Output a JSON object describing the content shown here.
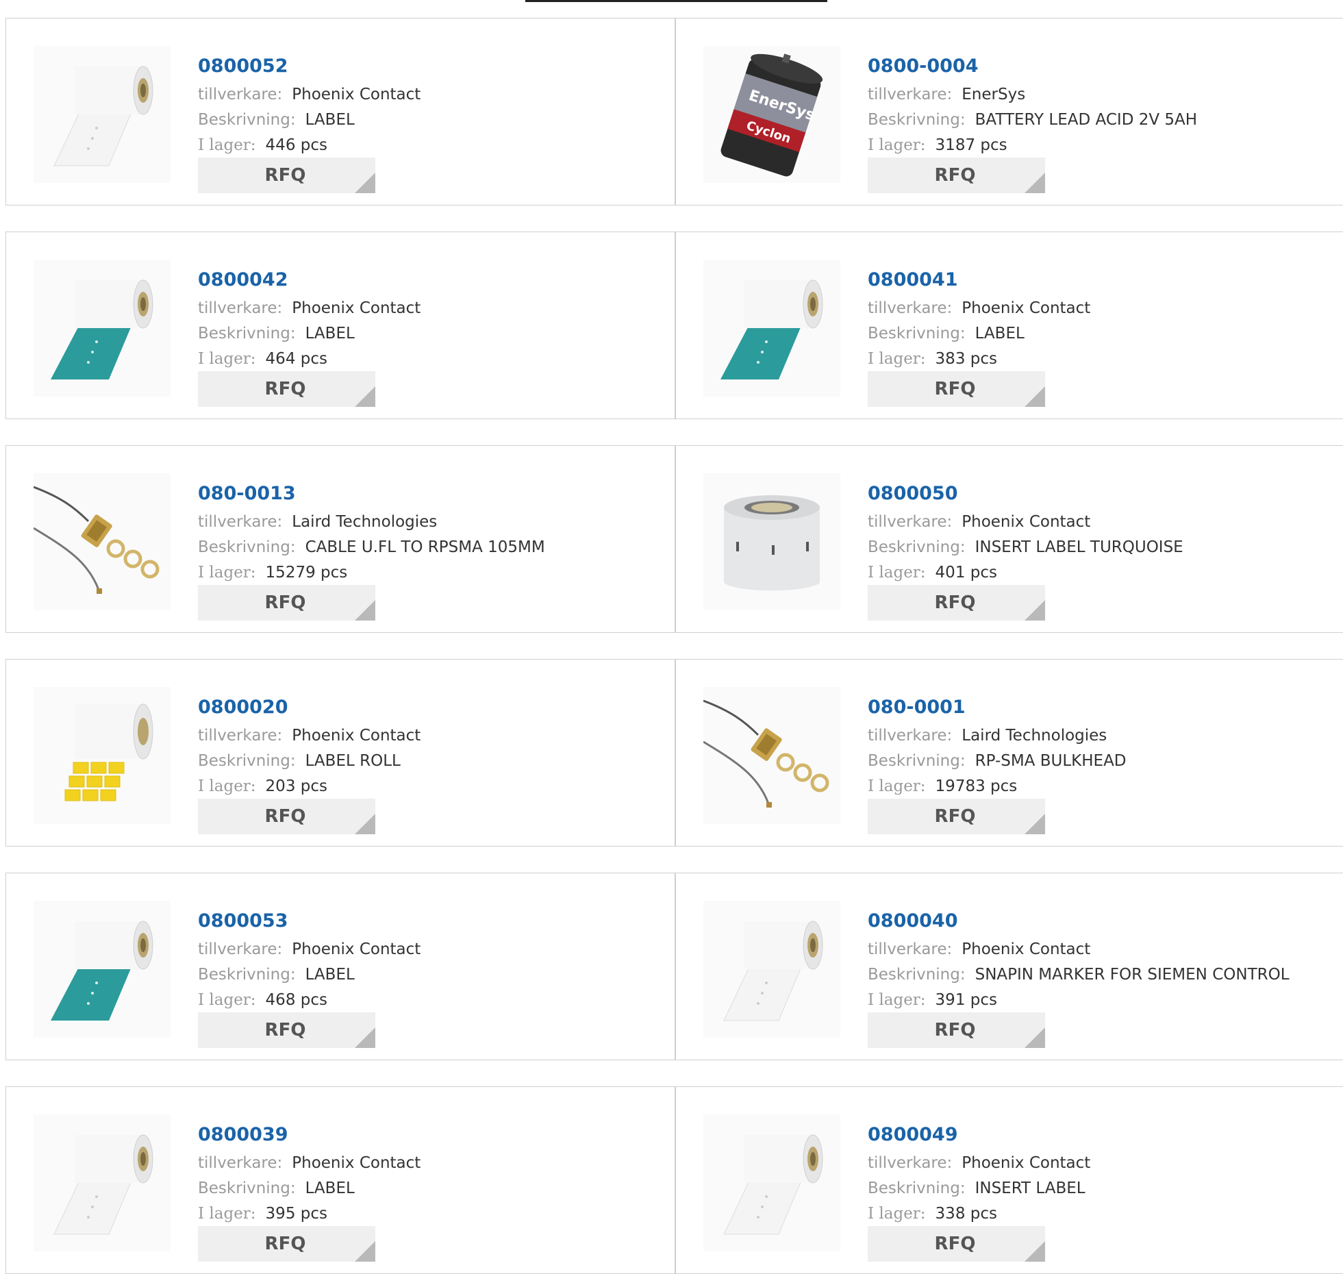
{
  "labels": {
    "manufacturer": "tillverkare:",
    "description": "Beskrivning:",
    "stock": "I lager:",
    "rfq": "RFQ"
  },
  "colors": {
    "part_link": "#1a63a8",
    "label_text": "#9a9a9a",
    "rfq_bg": "#efefef"
  },
  "products": [
    {
      "part": "0800052",
      "manufacturer": "Phoenix Contact",
      "description": "LABEL",
      "stock": "446 pcs",
      "image": "white-label-roll-icon"
    },
    {
      "part": "0800-0004",
      "manufacturer": "EnerSys",
      "description": "BATTERY LEAD ACID 2V 5AH",
      "stock": "3187 pcs",
      "image": "battery-icon"
    },
    {
      "part": "0800042",
      "manufacturer": "Phoenix Contact",
      "description": "LABEL",
      "stock": "464 pcs",
      "image": "teal-label-roll-icon"
    },
    {
      "part": "0800041",
      "manufacturer": "Phoenix Contact",
      "description": "LABEL",
      "stock": "383 pcs",
      "image": "teal-label-roll-icon"
    },
    {
      "part": "080-0013",
      "manufacturer": "Laird Technologies",
      "description": "CABLE U.FL TO RPSMA 105MM",
      "stock": "15279 pcs",
      "image": "rf-cable-icon"
    },
    {
      "part": "0800050",
      "manufacturer": "Phoenix Contact",
      "description": "INSERT LABEL TURQUOISE",
      "stock": "401 pcs",
      "image": "insert-label-roll-icon"
    },
    {
      "part": "0800020",
      "manufacturer": "Phoenix Contact",
      "description": "LABEL ROLL",
      "stock": "203 pcs",
      "image": "yellow-label-roll-icon"
    },
    {
      "part": "080-0001",
      "manufacturer": "Laird Technologies",
      "description": "RP-SMA BULKHEAD",
      "stock": "19783 pcs",
      "image": "rf-cable-icon"
    },
    {
      "part": "0800053",
      "manufacturer": "Phoenix Contact",
      "description": "LABEL",
      "stock": "468 pcs",
      "image": "teal-label-roll-icon"
    },
    {
      "part": "0800040",
      "manufacturer": "Phoenix Contact",
      "description": "SNAPIN MARKER FOR SIEMEN CONTROL",
      "stock": "391 pcs",
      "image": "white-label-roll-icon"
    },
    {
      "part": "0800039",
      "manufacturer": "Phoenix Contact",
      "description": "LABEL",
      "stock": "395 pcs",
      "image": "white-label-roll-icon"
    },
    {
      "part": "0800049",
      "manufacturer": "Phoenix Contact",
      "description": "INSERT LABEL",
      "stock": "338 pcs",
      "image": "white-label-roll-icon"
    }
  ]
}
